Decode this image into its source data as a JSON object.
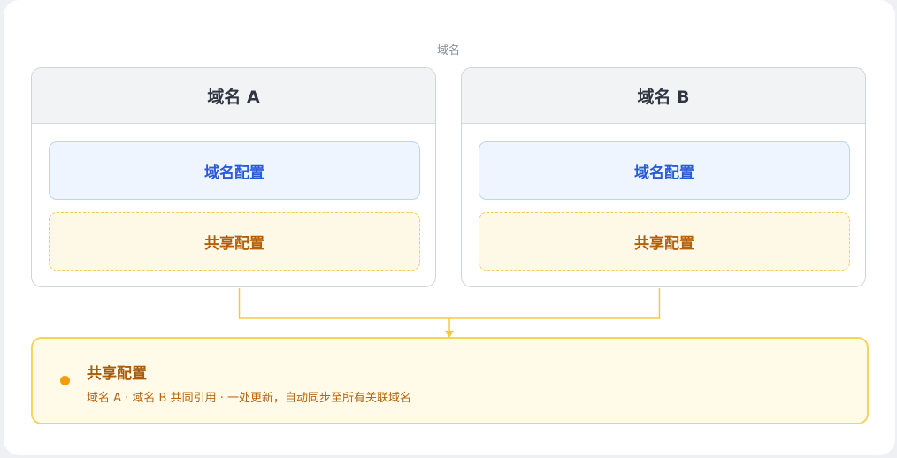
{
  "diagram": {
    "top_caption": "域名",
    "domains": [
      {
        "title": "域名 A",
        "domain_config_label": "域名配置",
        "shared_config_label": "共享配置"
      },
      {
        "title": "域名 B",
        "domain_config_label": "域名配置",
        "shared_config_label": "共享配置"
      }
    ],
    "shared_panel": {
      "title": "共享配置",
      "description": "域名 A · 域名 B 共同引用 · 一处更新，自动同步至所有关联域名"
    },
    "colors": {
      "domain_config_text": "#2a5bd7",
      "shared_config_text": "#b4600a",
      "connector": "#f5c842",
      "dot": "#f39c12"
    }
  }
}
